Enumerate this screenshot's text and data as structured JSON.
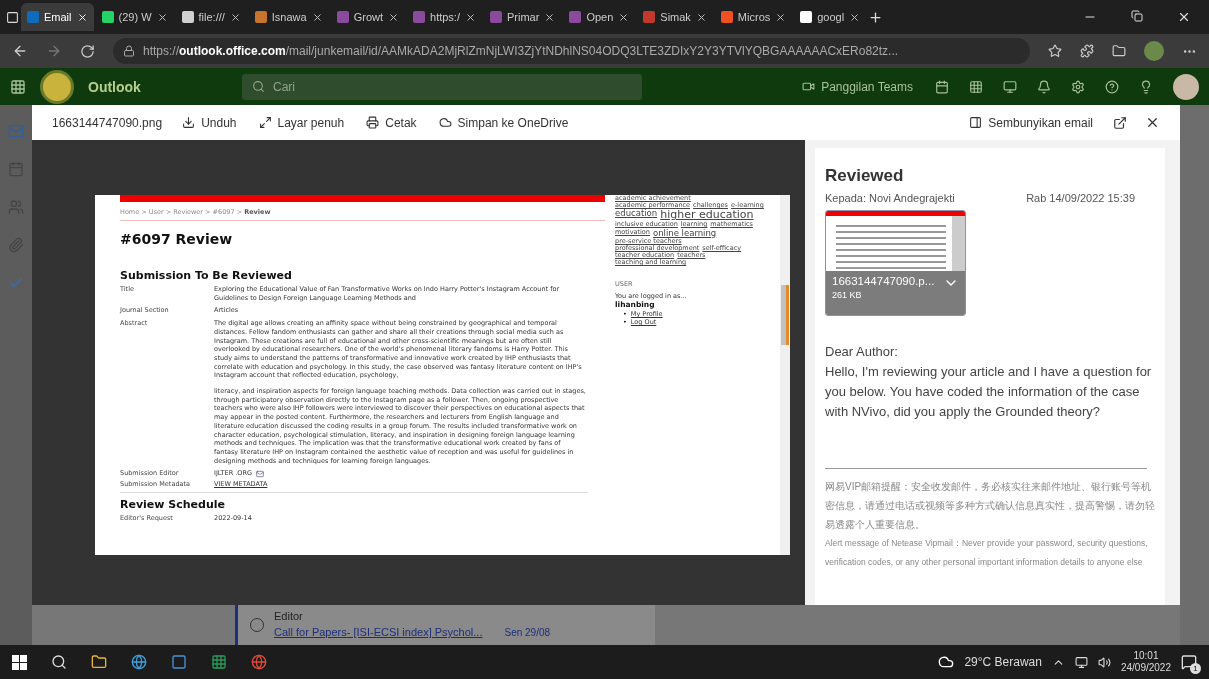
{
  "browser": {
    "tabs": [
      {
        "label": "Email",
        "color": "#0f6cbd",
        "selected": true
      },
      {
        "label": "(29) W",
        "color": "#25d366",
        "selected": false
      },
      {
        "label": "file:///",
        "color": "#d0d0d0",
        "selected": false
      },
      {
        "label": "Isnawa",
        "color": "#c8742c",
        "selected": false
      },
      {
        "label": "Growt",
        "color": "#8a4b9e",
        "selected": false
      },
      {
        "label": "https:/",
        "color": "#8a4b9e",
        "selected": false
      },
      {
        "label": "Primar",
        "color": "#8a4b9e",
        "selected": false
      },
      {
        "label": "Open",
        "color": "#8a4b9e",
        "selected": false
      },
      {
        "label": "Simak",
        "color": "#c0392b",
        "selected": false
      },
      {
        "label": "Micros",
        "color": "#f25022",
        "selected": false
      },
      {
        "label": "googl",
        "color": "#ffffff",
        "selected": false
      }
    ],
    "url": "https://**outlook.office.com**/mail/junkemail/id/AAMkADA2MjRlZmNjLWI3ZjYtNDhlNS04ODQ3LTE3ZDIxY2Y3YTVlYQBGAAAAAACxERo82tz..."
  },
  "outlook": {
    "app_name": "Outlook",
    "search_placeholder": "Cari",
    "teams_call": "Panggilan Teams"
  },
  "viewer": {
    "file_name": "1663144747090.png",
    "actions": [
      "Unduh",
      "Layar penuh",
      "Cetak",
      "Simpan ke OneDrive"
    ],
    "hide_email": "Sembunyikan email"
  },
  "document": {
    "breadcrumb": "Home > User > Reviewer > #6097 > **Review**",
    "heading": "#6097 Review",
    "section_title": "Submission To Be Reviewed",
    "fields": [
      {
        "label": "Title",
        "kind": "text",
        "paragraphs": [
          "Exploring the Educational Value of Fan Transformative Works on Indo Harry Potter's Instagram Account for Guidelines to Design Foreign Language Learning Methods and"
        ]
      },
      {
        "label": "Journal Section",
        "kind": "text",
        "paragraphs": [
          "Articles"
        ]
      },
      {
        "label": "Abstract",
        "kind": "text",
        "paragraphs": [
          "The digital age allows creating an affinity space without being constrained by geographical and temporal distances. Fellow fandom enthusiasts can gather and share all their creations through social media such as Instagram. These creations are full of educational and other cross-scientific meanings but are often still overlooked by educational researchers. One of the world's phenomenal literary fandoms is Harry Potter. This study aims to understand the patterns of transformative and innovative work created by IHP enthusiasts that correlate with education and psychology. In this study, the case observed was fantasy literature content on IHP's Instagram account that reflected education, psychology,",
          "literacy, and inspiration aspects for foreign language teaching methods. Data collection was carried out in stages, through participatory observation directly to the Instagram page as a follower. Then, ongoing prospective teachers who were also IHP followers were interviewed to discover their perspectives on educational aspects that may appear in the posted content. Furthermore, the researchers and lecturers from English language and literature education discussed the coding results in a group forum. The results included transformative work on character education, psychological stimulation, literacy, and inspiration in designing foreign language learning methods and techniques. The implication was that the transformative educational work created by fans of fantasy literature IHP on Instagram contained the aesthetic value of reception and was useful for guidelines in designing methods and techniques for learning foreign languages."
        ]
      },
      {
        "label": "Submission Editor",
        "kind": "editor",
        "paragraphs": [
          "IJLTER .ORG"
        ]
      },
      {
        "label": "Submission Metadata",
        "kind": "link",
        "paragraphs": [
          "VIEW METADATA"
        ]
      }
    ],
    "schedule_title": "Review Schedule",
    "schedule": [
      {
        "label": "Editor's Request",
        "value": "2022-09-14"
      }
    ],
    "tags": [
      {
        "text": "academic achievement",
        "kind": "normal"
      },
      {
        "text": "academic performance",
        "kind": "normal"
      },
      {
        "text": "challenges",
        "kind": "normal"
      },
      {
        "text": "e-learning",
        "kind": "normal"
      },
      {
        "text": "education",
        "kind": "medium"
      },
      {
        "text": "higher education",
        "kind": "large"
      },
      {
        "text": "inclusive education",
        "kind": "normal"
      },
      {
        "text": "learning",
        "kind": "normal"
      },
      {
        "text": "mathematics",
        "kind": "normal"
      },
      {
        "text": "motivation",
        "kind": "normal"
      },
      {
        "text": "online learning",
        "kind": "medium"
      },
      {
        "text": "pre-service teachers",
        "kind": "normal"
      },
      {
        "text": "professional development",
        "kind": "normal"
      },
      {
        "text": "self-efficacy",
        "kind": "normal"
      },
      {
        "text": "teacher education",
        "kind": "normal"
      },
      {
        "text": "teachers",
        "kind": "normal"
      },
      {
        "text": "teaching and learning",
        "kind": "normal"
      }
    ],
    "user_heading": "USER",
    "logged_in": "You are logged in as...",
    "username": "lihanbing",
    "user_links": [
      {
        "bullet": "•",
        "text": "My Profile"
      },
      {
        "bullet": "•",
        "text": "Log Out"
      }
    ]
  },
  "mail": {
    "subject": "Reviewed",
    "recipient": "Kepada: Novi Andegrajekti",
    "date": "Rab 14/09/2022 15:39",
    "attachment": {
      "name": "1663144747090.p...",
      "size": "261 KB"
    },
    "body": [
      "Dear Author:",
      "Hello, I'm reviewing your article and I have a question for you below. You have coded the information of the case with NVivo, did you apply the Grounded theory?"
    ],
    "notice_zh": "网易VIP邮箱提醒：安全收发邮件，务必核实往来邮件地址、银行账号等机密信息，请通过电话或视频等多种方式确认信息真实性，提高警惕，请勿轻易透露个人重要信息。",
    "notice_en": "Alert message of Netease Vipmail：Never provide your password, security questions, verification codes, or any other personal important information details to anyone else"
  },
  "background_mail": {
    "sender": "Editor",
    "subject": "Call for Papers- [ISI-ECSI index] Psychol...",
    "date": "Sen 29/08"
  },
  "taskbar": {
    "weather": "29°C Berawan",
    "time": "10:01",
    "date": "24/09/2022",
    "notifications": "1"
  }
}
